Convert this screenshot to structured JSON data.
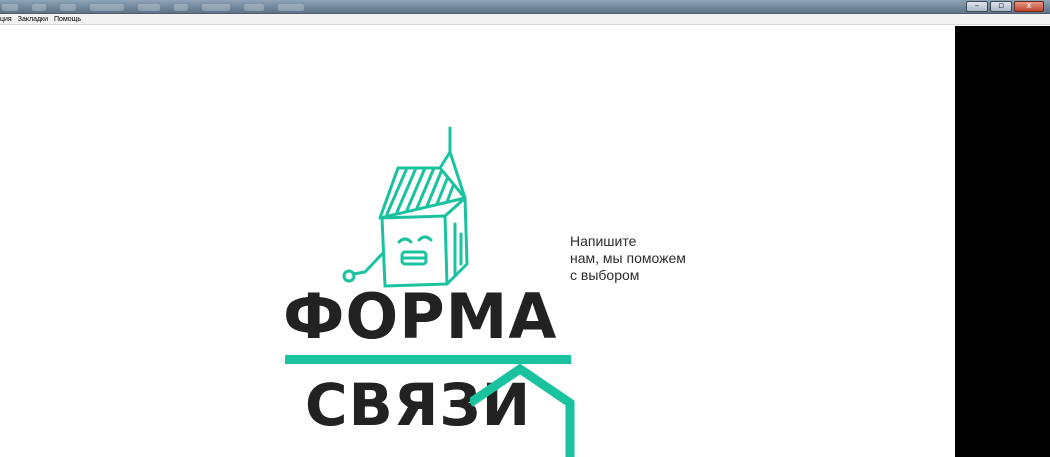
{
  "window": {
    "controls": {
      "minimize": "–",
      "maximize": "▫",
      "close": "x"
    }
  },
  "menubar": {
    "items": [
      "ция",
      "Закладки",
      "Помощь"
    ]
  },
  "contact": {
    "prompt_lines": [
      "Напишите",
      "нам, мы поможем",
      "с выбором"
    ],
    "title_line1": "ФОРМА",
    "title_line2": "СВЯЗИ"
  },
  "colors": {
    "accent": "#1bc2a0",
    "text_dark": "#222222",
    "side_panel": "#000000"
  },
  "icons": {
    "mascot": "birdhouse-mascot-icon",
    "roof": "roof-icon"
  }
}
